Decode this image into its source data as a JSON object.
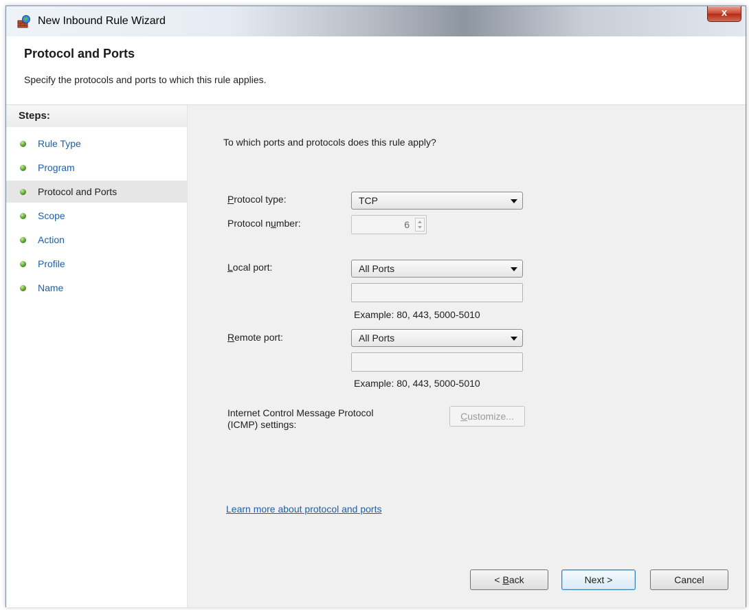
{
  "window": {
    "title": "New Inbound Rule Wizard",
    "close_label": "x"
  },
  "header": {
    "title": "Protocol and Ports",
    "subtitle": "Specify the protocols and ports to which this rule applies."
  },
  "steps": {
    "title": "Steps:",
    "items": [
      {
        "label": "Rule Type"
      },
      {
        "label": "Program"
      },
      {
        "label": "Protocol and Ports"
      },
      {
        "label": "Scope"
      },
      {
        "label": "Action"
      },
      {
        "label": "Profile"
      },
      {
        "label": "Name"
      }
    ]
  },
  "content": {
    "question": "To which ports and protocols does this rule apply?",
    "protocol_type": {
      "label_prefix": "P",
      "label_rest": "rotocol type:",
      "value": "TCP"
    },
    "protocol_number": {
      "label_prefix": "Protocol n",
      "label_u": "u",
      "label_rest": "mber:",
      "value": "6"
    },
    "local_port": {
      "label_u": "L",
      "label_rest": "ocal port:",
      "value": "All Ports",
      "input_value": "",
      "example": "Example: 80, 443, 5000-5010"
    },
    "remote_port": {
      "label_u": "R",
      "label_rest": "emote port:",
      "value": "All Ports",
      "input_value": "",
      "example": "Example: 80, 443, 5000-5010"
    },
    "icmp": {
      "label_line1": "Internet Control Message Protocol",
      "label_line2": "(ICMP) settings:",
      "customize_u": "C",
      "customize_rest": "ustomize..."
    },
    "learn_more": "Learn more about protocol and ports"
  },
  "buttons": {
    "back_prefix": "< ",
    "back_u": "B",
    "back_rest": "ack",
    "next": "Next >",
    "cancel": "Cancel"
  },
  "colors": {
    "link": "#1e5fa8",
    "step_bullet": "#5aa02c"
  }
}
